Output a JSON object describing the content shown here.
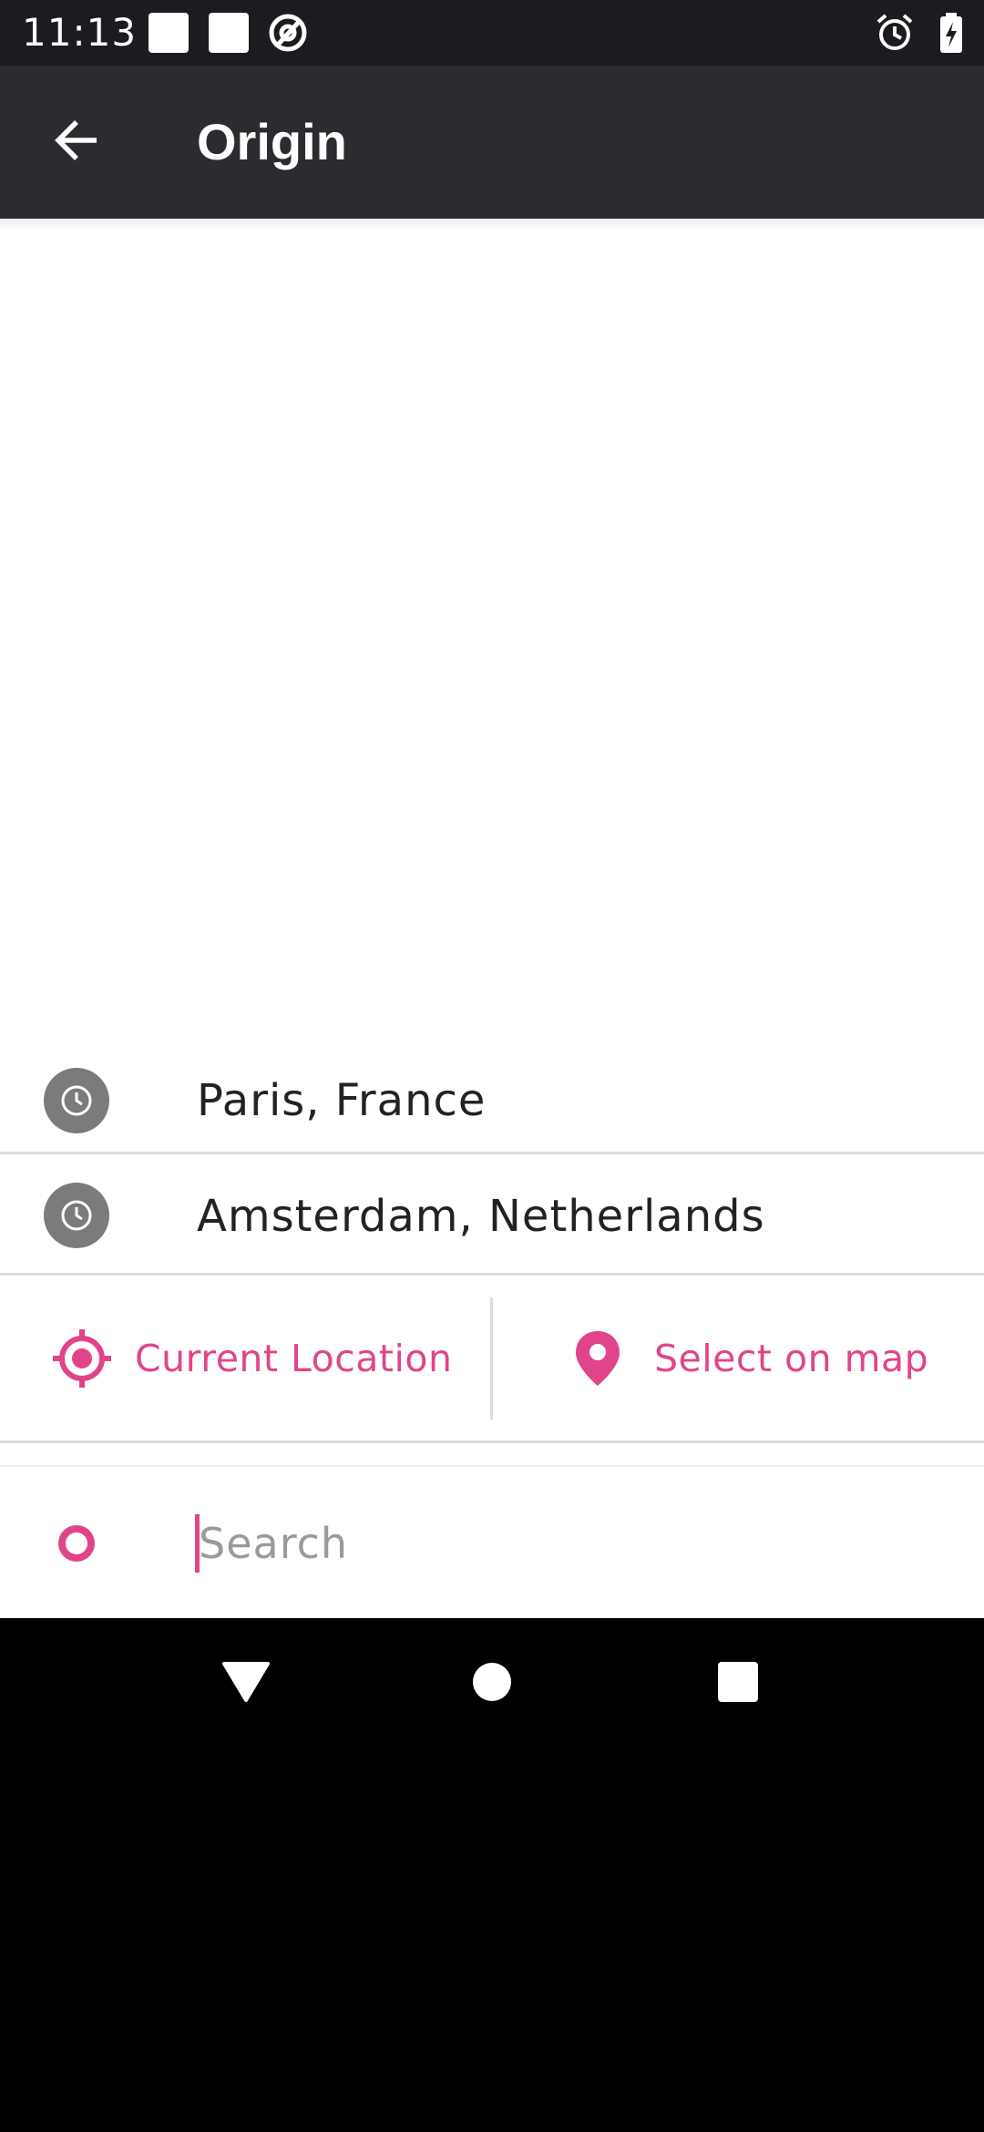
{
  "status_bar": {
    "time": "11:13",
    "icons": [
      "notification-square-icon",
      "notification-square-icon",
      "at-sign-icon",
      "alarm-icon",
      "battery-charging-icon"
    ]
  },
  "app_bar": {
    "title": "Origin",
    "back_icon": "arrow-left-icon"
  },
  "history": [
    {
      "label": "Paris, France",
      "icon": "clock-icon"
    },
    {
      "label": "Amsterdam, Netherlands",
      "icon": "clock-icon"
    }
  ],
  "actions": {
    "current_location": {
      "label": "Current Location",
      "icon": "crosshair-location-icon"
    },
    "select_on_map": {
      "label": "Select on map",
      "icon": "map-pin-icon"
    }
  },
  "search": {
    "placeholder": "Search",
    "value": "",
    "icon": "origin-dot-icon"
  },
  "nav_bar": {
    "buttons": [
      "back-triangle-icon",
      "home-circle-icon",
      "recents-square-icon"
    ]
  },
  "colors": {
    "accent": "#e0458b",
    "app_bar": "#2d2b30",
    "status_bar": "#1c1b1f",
    "history_icon_bg": "#7b7b7b"
  }
}
